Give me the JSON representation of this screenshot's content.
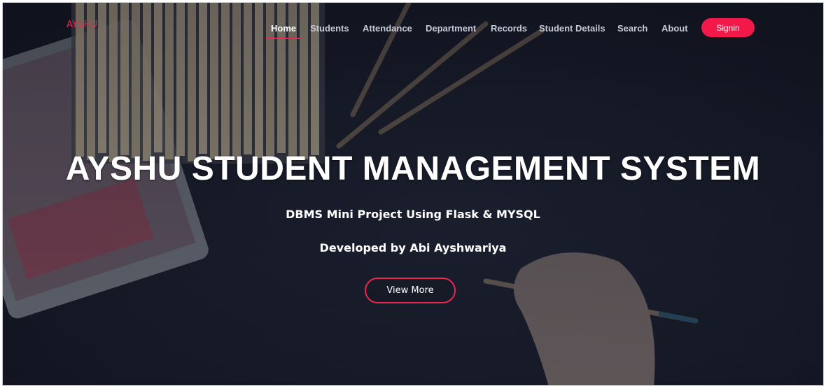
{
  "brand": "AYSHU",
  "nav": {
    "items": [
      {
        "label": "Home",
        "active": true
      },
      {
        "label": "Students",
        "active": false
      },
      {
        "label": "Attendance",
        "active": false
      },
      {
        "label": "Department",
        "active": false
      },
      {
        "label": "Records",
        "active": false
      },
      {
        "label": "Student Details",
        "active": false
      },
      {
        "label": "Search",
        "active": false
      },
      {
        "label": "About",
        "active": false
      }
    ],
    "signin_label": "Signin"
  },
  "hero": {
    "title": "AYSHU STUDENT MANAGEMENT SYSTEM",
    "subtitle": "DBMS Mini Project Using Flask & MYSQL",
    "developer": "Developed by Abi Ayshwariya",
    "button_label": "View More"
  },
  "colors": {
    "accent": "#e8284e",
    "background": "#1b1f2f",
    "nav_text": "#c7cad4"
  }
}
